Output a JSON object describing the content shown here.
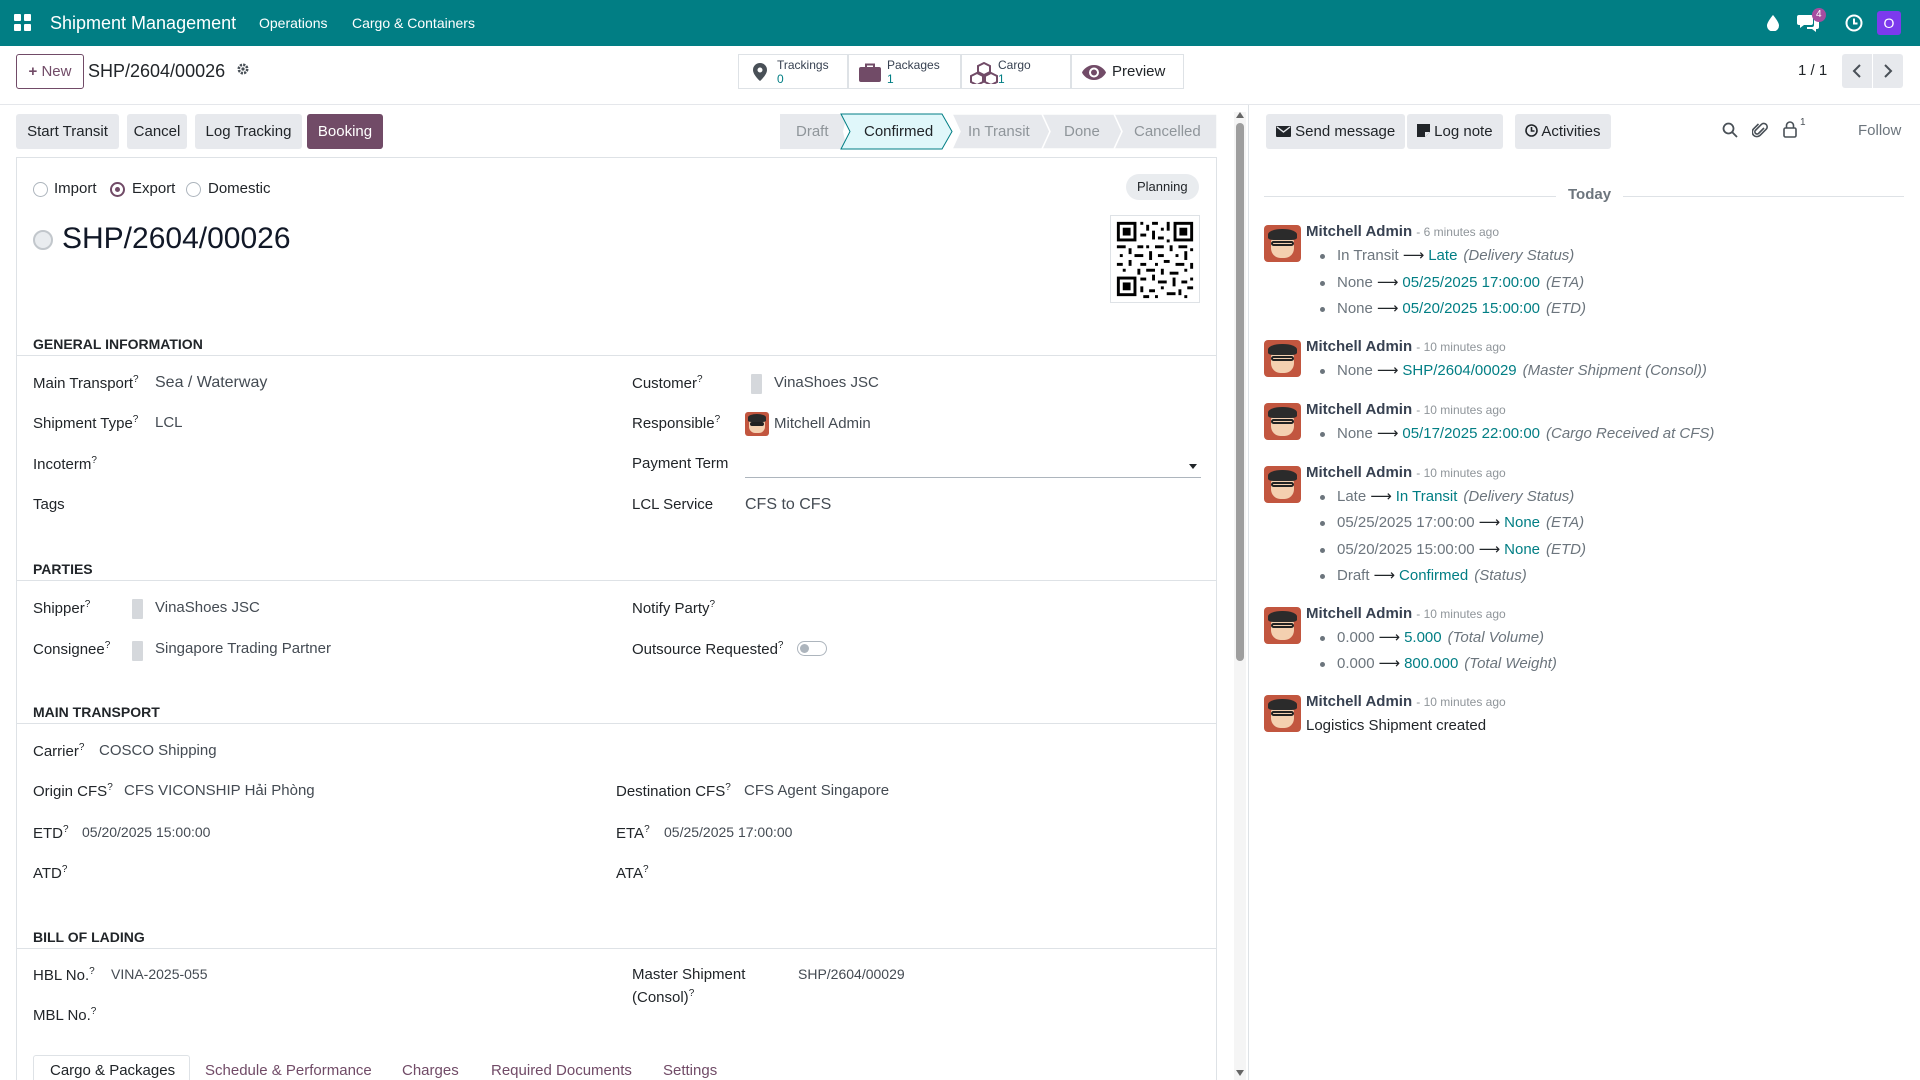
{
  "nav": {
    "app_title": "Shipment Management",
    "menu": [
      "Operations",
      "Cargo & Containers"
    ],
    "discuss_count": "4",
    "user_initial": "O"
  },
  "control": {
    "new_label": "New",
    "record_name": "SHP/2604/00026",
    "pager": "1 / 1",
    "smart_buttons": [
      {
        "label": "Trackings",
        "value": "0"
      },
      {
        "label": "Packages",
        "value": "1"
      },
      {
        "label": "Cargo",
        "value": "1"
      },
      {
        "label": "Preview",
        "value": ""
      }
    ]
  },
  "actions": [
    "Start Transit",
    "Cancel",
    "Log Tracking",
    "Booking"
  ],
  "stages": [
    "Draft",
    "Confirmed",
    "In Transit",
    "Done",
    "Cancelled"
  ],
  "active_stage": "Confirmed",
  "form": {
    "direction_options": [
      "Import",
      "Export",
      "Domestic"
    ],
    "direction_selected": "Export",
    "title": "SHP/2604/00026",
    "stage_badge": "Planning",
    "sections": {
      "general": "GENERAL INFORMATION",
      "parties": "PARTIES",
      "main_transport": "MAIN TRANSPORT",
      "bol": "BILL OF LADING"
    },
    "general": {
      "main_transport_label": "Main Transport",
      "main_transport": "Sea / Waterway",
      "shipment_type_label": "Shipment Type",
      "shipment_type": "LCL",
      "incoterm_label": "Incoterm",
      "tags_label": "Tags",
      "customer_label": "Customer",
      "customer": "VinaShoes JSC",
      "responsible_label": "Responsible",
      "responsible": "Mitchell Admin",
      "payment_term_label": "Payment Term",
      "lcl_service_label": "LCL Service",
      "lcl_service": "CFS to CFS"
    },
    "parties": {
      "shipper_label": "Shipper",
      "shipper": "VinaShoes JSC",
      "consignee_label": "Consignee",
      "consignee": "Singapore Trading Partner",
      "notify_label": "Notify Party",
      "outsource_label": "Outsource Requested"
    },
    "transport": {
      "carrier_label": "Carrier",
      "carrier": "COSCO Shipping",
      "origin_label": "Origin CFS",
      "origin": "CFS VICONSHIP Hải Phòng",
      "dest_label": "Destination CFS",
      "dest": "CFS Agent Singapore",
      "etd_label": "ETD",
      "etd": "05/20/2025 15:00:00",
      "eta_label": "ETA",
      "eta": "05/25/2025 17:00:00",
      "atd_label": "ATD",
      "ata_label": "ATA"
    },
    "bol": {
      "hbl_label": "HBL No.",
      "hbl": "VINA-2025-055",
      "mbl_label": "MBL No.",
      "master_label_1": "Master Shipment",
      "master_label_2": "(Consol)",
      "master": "SHP/2604/00029"
    },
    "tabs": [
      "Cargo & Packages",
      "Schedule & Performance",
      "Charges",
      "Required Documents",
      "Settings"
    ]
  },
  "chatter": {
    "send_message": "Send message",
    "log_note": "Log note",
    "activities": "Activities",
    "followers_count": "1",
    "follow": "Follow",
    "day": "Today",
    "messages": [
      {
        "author": "Mitchell Admin",
        "time": "- 6 minutes ago",
        "changes": [
          {
            "old": "In Transit",
            "new": "Late",
            "field": "(Delivery Status)"
          },
          {
            "old": "None",
            "new": "05/25/2025 17:00:00",
            "field": "(ETA)"
          },
          {
            "old": "None",
            "new": "05/20/2025 15:00:00",
            "field": "(ETD)"
          }
        ]
      },
      {
        "author": "Mitchell Admin",
        "time": "- 10 minutes ago",
        "changes": [
          {
            "old": "None",
            "new": "SHP/2604/00029",
            "field": "(Master Shipment (Consol))"
          }
        ]
      },
      {
        "author": "Mitchell Admin",
        "time": "- 10 minutes ago",
        "changes": [
          {
            "old": "None",
            "new": "05/17/2025 22:00:00",
            "field": "(Cargo Received at CFS)"
          }
        ]
      },
      {
        "author": "Mitchell Admin",
        "time": "- 10 minutes ago",
        "changes": [
          {
            "old": "Late",
            "new": "In Transit",
            "field": "(Delivery Status)"
          },
          {
            "old": "05/25/2025 17:00:00",
            "new": "None",
            "field": "(ETA)"
          },
          {
            "old": "05/20/2025 15:00:00",
            "new": "None",
            "field": "(ETD)"
          },
          {
            "old": "Draft",
            "new": "Confirmed",
            "field": "(Status)"
          }
        ]
      },
      {
        "author": "Mitchell Admin",
        "time": "- 10 minutes ago",
        "changes": [
          {
            "old": "0.000",
            "new": "5.000",
            "field": "(Total Volume)"
          },
          {
            "old": "0.000",
            "new": "800.000",
            "field": "(Total Weight)"
          }
        ]
      },
      {
        "author": "Mitchell Admin",
        "time": "- 10 minutes ago",
        "body": "Logistics Shipment created"
      }
    ]
  }
}
